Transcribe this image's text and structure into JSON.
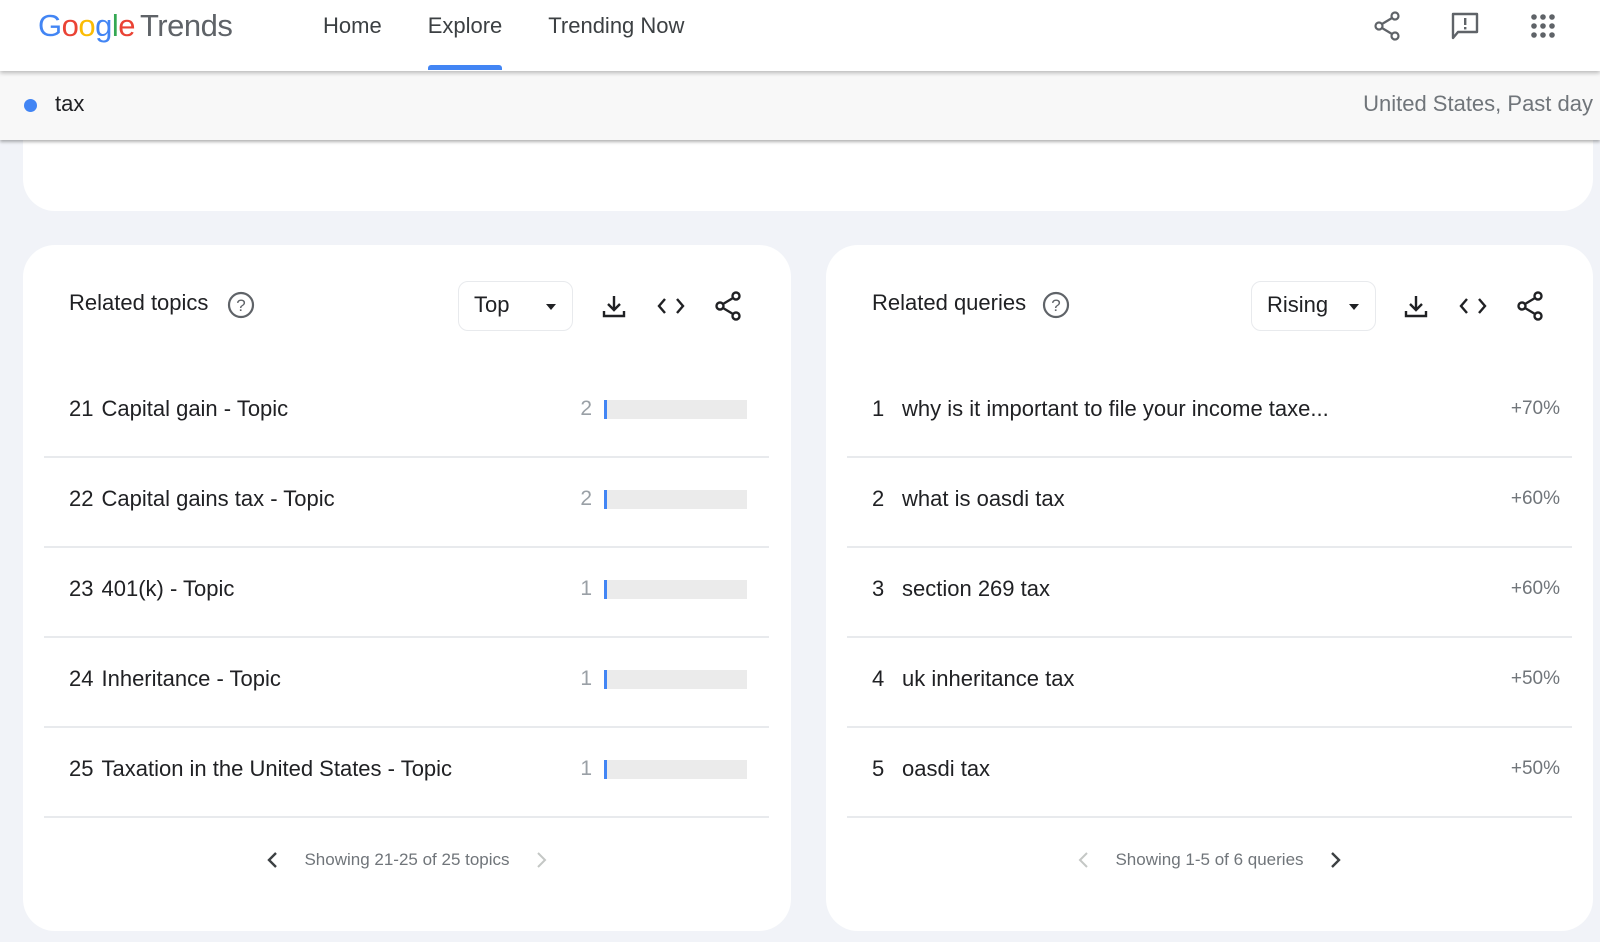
{
  "header": {
    "logo": {
      "google": [
        "G",
        "o",
        "o",
        "g",
        "l",
        "e"
      ],
      "product": "Trends"
    },
    "nav": [
      {
        "label": "Home",
        "active": false
      },
      {
        "label": "Explore",
        "active": true
      },
      {
        "label": "Trending Now",
        "active": false
      }
    ],
    "icons": [
      "share-icon",
      "feedback-icon",
      "apps-grid-icon"
    ]
  },
  "search": {
    "term": "tax",
    "term_color": "#4285f4",
    "scope": "United States, Past day"
  },
  "related_topics": {
    "title": "Related topics",
    "mode": "Top",
    "rows": [
      {
        "rank": "21",
        "label": "Capital gain - Topic",
        "value": "2",
        "fill": 2
      },
      {
        "rank": "22",
        "label": "Capital gains tax - Topic",
        "value": "2",
        "fill": 2
      },
      {
        "rank": "23",
        "label": "401(k) - Topic",
        "value": "1",
        "fill": 1
      },
      {
        "rank": "24",
        "label": "Inheritance - Topic",
        "value": "1",
        "fill": 1
      },
      {
        "rank": "25",
        "label": "Taxation in the United States - Topic",
        "value": "1",
        "fill": 1
      }
    ],
    "pager": "Showing 21-25 of 25 topics",
    "prev_enabled": true,
    "next_enabled": false
  },
  "related_queries": {
    "title": "Related queries",
    "mode": "Rising",
    "rows": [
      {
        "rank": "1",
        "label": "why is it important to file your income taxe...",
        "value": "+70%"
      },
      {
        "rank": "2",
        "label": "what is oasdi tax",
        "value": "+60%"
      },
      {
        "rank": "3",
        "label": "section 269 tax",
        "value": "+60%"
      },
      {
        "rank": "4",
        "label": "uk inheritance tax",
        "value": "+50%"
      },
      {
        "rank": "5",
        "label": "oasdi tax",
        "value": "+50%"
      }
    ],
    "pager": "Showing 1-5 of 6 queries",
    "prev_enabled": false,
    "next_enabled": true
  },
  "colors": {
    "accent": "#4285f4",
    "bar_bg": "#ebebeb",
    "page_bg": "#f1f3f8"
  }
}
